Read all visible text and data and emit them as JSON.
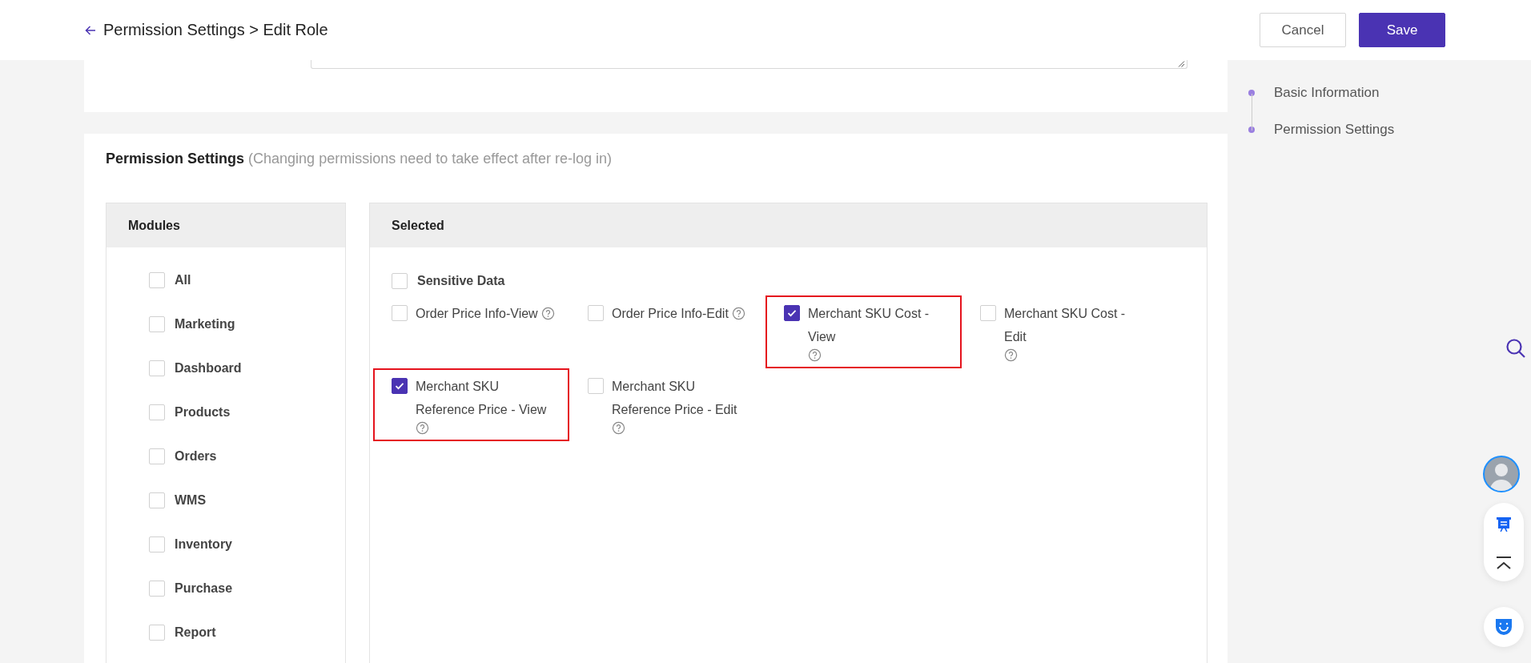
{
  "header": {
    "title": "Permission Settings > Edit Role",
    "buttons": [
      {
        "label": "Cancel",
        "kind": "secondary"
      },
      {
        "label": "Save",
        "kind": "primary"
      }
    ]
  },
  "anchor_nav": [
    {
      "label": "Basic Information"
    },
    {
      "label": "Permission Settings"
    }
  ],
  "permission_settings": {
    "title": "Permission Settings",
    "note": "(Changing permissions need to take effect after re-log in)",
    "modules": {
      "heading": "Modules",
      "items": [
        {
          "label": "All",
          "checked": false
        },
        {
          "label": "Marketing",
          "checked": false
        },
        {
          "label": "Dashboard",
          "checked": false
        },
        {
          "label": "Products",
          "checked": false
        },
        {
          "label": "Orders",
          "checked": false
        },
        {
          "label": "WMS",
          "checked": false
        },
        {
          "label": "Inventory",
          "checked": false
        },
        {
          "label": "Purchase",
          "checked": false
        },
        {
          "label": "Report",
          "checked": false
        }
      ]
    },
    "selected": {
      "heading": "Selected",
      "group": {
        "label": "Sensitive Data",
        "checked": false
      },
      "items": [
        {
          "label": "Order Price Info-View",
          "checked": false,
          "highlighted": false
        },
        {
          "label": "Order Price Info-Edit",
          "checked": false,
          "highlighted": false
        },
        {
          "label": "Merchant SKU Cost - View",
          "checked": true,
          "highlighted": true
        },
        {
          "label": "Merchant SKU Cost - Edit",
          "checked": false,
          "highlighted": false
        },
        {
          "label": "Merchant SKU Reference Price - View",
          "checked": true,
          "highlighted": true
        },
        {
          "label": "Merchant SKU Reference Price - Edit",
          "checked": false,
          "highlighted": false
        }
      ]
    }
  }
}
